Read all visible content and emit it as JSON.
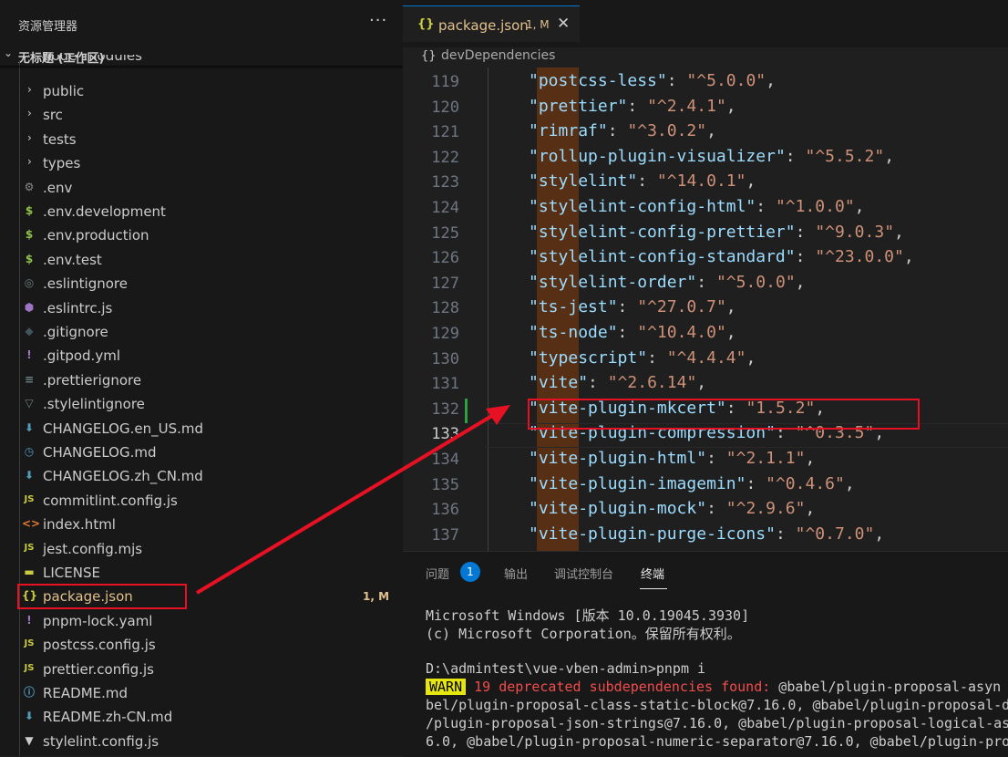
{
  "explorer": {
    "title": "资源管理器",
    "more": "···",
    "workspace": "无标题 (工作区)",
    "partial_folder": "node_modules",
    "items": [
      {
        "type": "folder",
        "label": "public"
      },
      {
        "type": "folder",
        "label": "src"
      },
      {
        "type": "folder",
        "label": "tests"
      },
      {
        "type": "folder",
        "label": "types"
      },
      {
        "type": "file",
        "label": ".env",
        "icon": "gear-icon",
        "glyph": "⚙",
        "color": "#8a8a8a"
      },
      {
        "type": "file",
        "label": ".env.development",
        "icon": "dollar-icon",
        "glyph": "$",
        "color": "#8dc149"
      },
      {
        "type": "file",
        "label": ".env.production",
        "icon": "dollar-icon",
        "glyph": "$",
        "color": "#8dc149"
      },
      {
        "type": "file",
        "label": ".env.test",
        "icon": "dollar-icon",
        "glyph": "$",
        "color": "#8dc149"
      },
      {
        "type": "file",
        "label": ".eslintignore",
        "icon": "eslint-icon",
        "glyph": "◎",
        "color": "#6d8086"
      },
      {
        "type": "file",
        "label": ".eslintrc.js",
        "icon": "eslint-icon",
        "glyph": "⬢",
        "color": "#a074c4"
      },
      {
        "type": "file",
        "label": ".gitignore",
        "icon": "git-icon",
        "glyph": "◆",
        "color": "#41535b"
      },
      {
        "type": "file",
        "label": ".gitpod.yml",
        "icon": "yaml-icon",
        "glyph": "!",
        "color": "#a074c4"
      },
      {
        "type": "file",
        "label": ".prettierignore",
        "icon": "prettier-icon",
        "glyph": "≡",
        "color": "#6d8086"
      },
      {
        "type": "file",
        "label": ".stylelintignore",
        "icon": "stylelint-icon",
        "glyph": "▽",
        "color": "#6d8086"
      },
      {
        "type": "file",
        "label": "CHANGELOG.en_US.md",
        "icon": "markdown-icon",
        "glyph": "⬇",
        "color": "#519aba"
      },
      {
        "type": "file",
        "label": "CHANGELOG.md",
        "icon": "clock-icon",
        "glyph": "◷",
        "color": "#519aba"
      },
      {
        "type": "file",
        "label": "CHANGELOG.zh_CN.md",
        "icon": "markdown-icon",
        "glyph": "⬇",
        "color": "#519aba"
      },
      {
        "type": "file",
        "label": "commitlint.config.js",
        "icon": "js-icon",
        "glyph": "JS",
        "color": "#cbcb41"
      },
      {
        "type": "file",
        "label": "index.html",
        "icon": "html-icon",
        "glyph": "<>",
        "color": "#e37933"
      },
      {
        "type": "file",
        "label": "jest.config.mjs",
        "icon": "js-icon",
        "glyph": "JS",
        "color": "#cbcb41"
      },
      {
        "type": "file",
        "label": "LICENSE",
        "icon": "license-icon",
        "glyph": "▬",
        "color": "#cbcb41"
      },
      {
        "type": "file",
        "label": "package.json",
        "icon": "json-icon",
        "glyph": "{}",
        "color": "#cbcb41",
        "badge": "1, M",
        "modified": true
      },
      {
        "type": "file",
        "label": "pnpm-lock.yaml",
        "icon": "yaml-icon",
        "glyph": "!",
        "color": "#a074c4"
      },
      {
        "type": "file",
        "label": "postcss.config.js",
        "icon": "js-icon",
        "glyph": "JS",
        "color": "#cbcb41"
      },
      {
        "type": "file",
        "label": "prettier.config.js",
        "icon": "js-icon",
        "glyph": "JS",
        "color": "#cbcb41"
      },
      {
        "type": "file",
        "label": "README.md",
        "icon": "info-icon",
        "glyph": "ⓘ",
        "color": "#519aba"
      },
      {
        "type": "file",
        "label": "README.zh-CN.md",
        "icon": "markdown-icon",
        "glyph": "⬇",
        "color": "#519aba"
      },
      {
        "type": "file",
        "label": "stylelint.config.js",
        "icon": "stylelint-icon",
        "glyph": "▼",
        "color": "#cccccc"
      }
    ]
  },
  "editor": {
    "tab": {
      "icon": "{}",
      "label": "package.json",
      "badge": "1, M",
      "close": "✕"
    },
    "breadcrumb": {
      "icon": "{}",
      "label": "devDependencies"
    },
    "active_line": 133,
    "modified_line": 132,
    "lines": [
      {
        "n": "119",
        "key": "postcss-less",
        "val": "^5.0.0"
      },
      {
        "n": "120",
        "key": "prettier",
        "val": "^2.4.1"
      },
      {
        "n": "121",
        "key": "rimraf",
        "val": "^3.0.2"
      },
      {
        "n": "122",
        "key": "rollup-plugin-visualizer",
        "val": "^5.5.2"
      },
      {
        "n": "123",
        "key": "stylelint",
        "val": "^14.0.1"
      },
      {
        "n": "124",
        "key": "stylelint-config-html",
        "val": "^1.0.0"
      },
      {
        "n": "125",
        "key": "stylelint-config-prettier",
        "val": "^9.0.3"
      },
      {
        "n": "126",
        "key": "stylelint-config-standard",
        "val": "^23.0.0"
      },
      {
        "n": "127",
        "key": "stylelint-order",
        "val": "^5.0.0"
      },
      {
        "n": "128",
        "key": "ts-jest",
        "val": "^27.0.7"
      },
      {
        "n": "129",
        "key": "ts-node",
        "val": "^10.4.0"
      },
      {
        "n": "130",
        "key": "typescript",
        "val": "^4.4.4"
      },
      {
        "n": "131",
        "key": "vite",
        "val": "^2.6.14"
      },
      {
        "n": "132",
        "key": "vite-plugin-mkcert",
        "val": "1.5.2"
      },
      {
        "n": "133",
        "key": "vite-plugin-compression",
        "val": "^0.3.5"
      },
      {
        "n": "134",
        "key": "vite-plugin-html",
        "val": "^2.1.1"
      },
      {
        "n": "135",
        "key": "vite-plugin-imagemin",
        "val": "^0.4.6"
      },
      {
        "n": "136",
        "key": "vite-plugin-mock",
        "val": "^2.9.6"
      },
      {
        "n": "137",
        "key": "vite-plugin-purge-icons",
        "val": "^0.7.0"
      }
    ]
  },
  "panel": {
    "tabs": [
      {
        "label": "问题",
        "badge": "1"
      },
      {
        "label": "输出"
      },
      {
        "label": "调试控制台"
      },
      {
        "label": "终端",
        "active": true
      }
    ],
    "terminal": {
      "line1": "Microsoft Windows [版本 10.0.19045.3930]",
      "line2": "(c) Microsoft Corporation。保留所有权利。",
      "prompt": "D:\\admintest\\vue-vben-admin>pnpm i",
      "warn_tag": "WARN",
      "warn_msg": "19 deprecated subdependencies found:",
      "warn_rest": "@babel/plugin-proposal-asyn",
      "l5": "bel/plugin-proposal-class-static-block@7.16.0, @babel/plugin-proposal-d",
      "l6": "/plugin-proposal-json-strings@7.16.0, @babel/plugin-proposal-logical-as",
      "l7": "6.0, @babel/plugin-proposal-numeric-separator@7.16.0, @babel/plugin-pro"
    }
  },
  "colors": {
    "annotation": "#e81123",
    "accent": "#0078d4"
  }
}
